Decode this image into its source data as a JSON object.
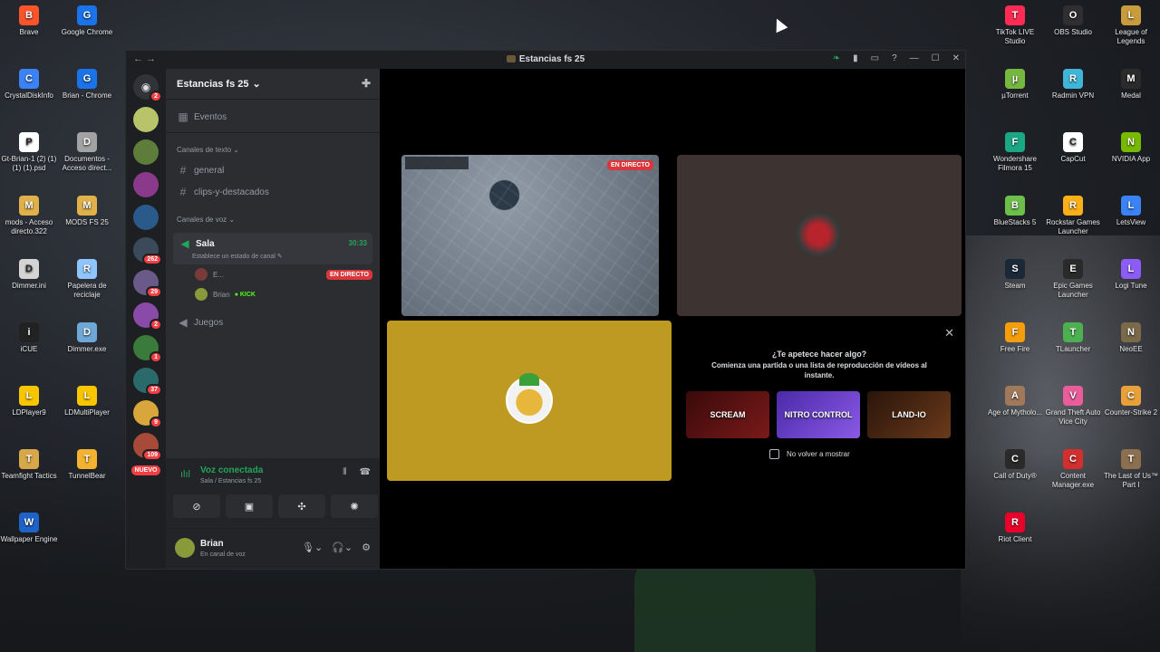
{
  "desktop": {
    "left_icons": [
      {
        "label": "Brave",
        "color": "#fb542b",
        "glyph": "B"
      },
      {
        "label": "Google Chrome",
        "color": "#1a73e8",
        "glyph": "G"
      },
      {
        "label": "CrystalDiskInfo",
        "color": "#3b82f6",
        "glyph": "C"
      },
      {
        "label": "Brian - Chrome",
        "color": "#1a73e8",
        "glyph": "G"
      },
      {
        "label": "Gt-Brian-1 (2) (1) (1) (1).psd",
        "color": "#ffffff",
        "glyph": "P"
      },
      {
        "label": "Documentos - Acceso direct...",
        "color": "#a3a3a3",
        "glyph": "D"
      },
      {
        "label": "mods - Acceso directo.322",
        "color": "#e0b04a",
        "glyph": "M"
      },
      {
        "label": "MODS FS 25",
        "color": "#e0b04a",
        "glyph": "M"
      },
      {
        "label": "Dimmer.ini",
        "color": "#d4d4d4",
        "glyph": "D"
      },
      {
        "label": "Papelera de reciclaje",
        "color": "#8ec5ff",
        "glyph": "R"
      },
      {
        "label": "iCUE",
        "color": "#222222",
        "glyph": "i"
      },
      {
        "label": "Dimmer.exe",
        "color": "#6ea8d6",
        "glyph": "D"
      },
      {
        "label": "LDPlayer9",
        "color": "#f7c600",
        "glyph": "L"
      },
      {
        "label": "LDMultiPlayer",
        "color": "#f7c600",
        "glyph": "L"
      },
      {
        "label": "Teamfight Tactics",
        "color": "#d6a84a",
        "glyph": "T"
      },
      {
        "label": "TunnelBear",
        "color": "#f3b22f",
        "glyph": "T"
      },
      {
        "label": "Wallpaper Engine",
        "color": "#1e64c8",
        "glyph": "W"
      }
    ],
    "right_icons": [
      {
        "label": "TikTok LIVE Studio",
        "color": "#fe2c55",
        "glyph": "T"
      },
      {
        "label": "OBS Studio",
        "color": "#302e31",
        "glyph": "O"
      },
      {
        "label": "League of Legends",
        "color": "#c89b3c",
        "glyph": "L"
      },
      {
        "label": "µTorrent",
        "color": "#76b83f",
        "glyph": "µ"
      },
      {
        "label": "Radmin VPN",
        "color": "#3fb6d8",
        "glyph": "R"
      },
      {
        "label": "Medal",
        "color": "#2b2b2b",
        "glyph": "M"
      },
      {
        "label": "Wondershare Filmora 15",
        "color": "#1ba784",
        "glyph": "F"
      },
      {
        "label": "CapCut",
        "color": "#ffffff",
        "glyph": "C"
      },
      {
        "label": "NVIDIA App",
        "color": "#76b900",
        "glyph": "N"
      },
      {
        "label": "BlueStacks 5",
        "color": "#6cc04a",
        "glyph": "B"
      },
      {
        "label": "Rockstar Games Launcher",
        "color": "#fcaf17",
        "glyph": "R"
      },
      {
        "label": "LetsView",
        "color": "#3b82f6",
        "glyph": "L"
      },
      {
        "label": "Steam",
        "color": "#1b2838",
        "glyph": "S"
      },
      {
        "label": "Epic Games Launcher",
        "color": "#2a2a2a",
        "glyph": "E"
      },
      {
        "label": "Logi Tune",
        "color": "#8b5cf6",
        "glyph": "L"
      },
      {
        "label": "Free Fire",
        "color": "#f59e0b",
        "glyph": "F"
      },
      {
        "label": "TLauncher",
        "color": "#4caf50",
        "glyph": "T"
      },
      {
        "label": "NeoEE",
        "color": "#7a6a4a",
        "glyph": "N"
      },
      {
        "label": "Age of Mytholo...",
        "color": "#a0785a",
        "glyph": "A"
      },
      {
        "label": "Grand Theft Auto Vice City",
        "color": "#e85d9a",
        "glyph": "V"
      },
      {
        "label": "Counter-Strike 2",
        "color": "#e8a13a",
        "glyph": "C"
      },
      {
        "label": "Call of Duty®",
        "color": "#2a2a2a",
        "glyph": "C"
      },
      {
        "label": "Content Manager.exe",
        "color": "#d32f2f",
        "glyph": "C"
      },
      {
        "label": "The Last of Us™ Part I",
        "color": "#8b6f4e",
        "glyph": "T"
      },
      {
        "label": "Riot Client",
        "color": "#eb0029",
        "glyph": "R"
      }
    ]
  },
  "window": {
    "title": "Estancias fs 25"
  },
  "rail": {
    "home_badge": "2",
    "servers": [
      {
        "color": "#b8c36a",
        "badge": ""
      },
      {
        "color": "#5e7d3a",
        "badge": ""
      },
      {
        "color": "#8b3a8b",
        "badge": ""
      },
      {
        "color": "#2a5a8a",
        "badge": ""
      },
      {
        "color": "#3a4a5a",
        "badge": "262"
      },
      {
        "color": "#6a5a8a",
        "badge": "29"
      },
      {
        "color": "#8a4aa8",
        "badge": "2"
      },
      {
        "color": "#3a7a3a",
        "badge": "1"
      },
      {
        "color": "#2a6a6a",
        "badge": "37"
      },
      {
        "color": "#d8a63a",
        "badge": "9"
      },
      {
        "color": "#a84a3a",
        "badge": "109"
      }
    ],
    "new_label": "NUEVO"
  },
  "sidebar": {
    "guild_name": "Estancias fs 25",
    "events_label": "Eventos",
    "text_category": "Canales de texto",
    "text_channels": [
      "general",
      "clips-y-destacados"
    ],
    "voice_category": "Canales de voz",
    "active_voice": {
      "name": "Sala",
      "timer": "30:33",
      "status": "Establece un estado de canal"
    },
    "members": [
      {
        "name": "E...",
        "badge": "EN DIRECTO",
        "avatar_color": "#7a3a3a"
      },
      {
        "name": "Brian",
        "badge": "KICK",
        "avatar_color": "#8a9a3a"
      }
    ],
    "other_voice": "Juegos"
  },
  "voice_panel": {
    "title": "Voz conectada",
    "subtitle": "Sala / Estancias fs 25"
  },
  "user_panel": {
    "name": "Brian",
    "status": "En canal de voz"
  },
  "stage": {
    "live_badge": "EN DIRECTO",
    "promo": {
      "question": "¿Te apetece hacer algo?",
      "description": "Comienza una partida o una lista de reproducción de vídeos al instante.",
      "cards": [
        {
          "label": "SCREAM",
          "color": "#7a1a1a"
        },
        {
          "label": "NITRO CONTROL",
          "color": "#6b3fd6"
        },
        {
          "label": "LAND-IO",
          "color": "#5a2a1a"
        }
      ],
      "checkbox_label": "No volver a mostrar"
    }
  }
}
